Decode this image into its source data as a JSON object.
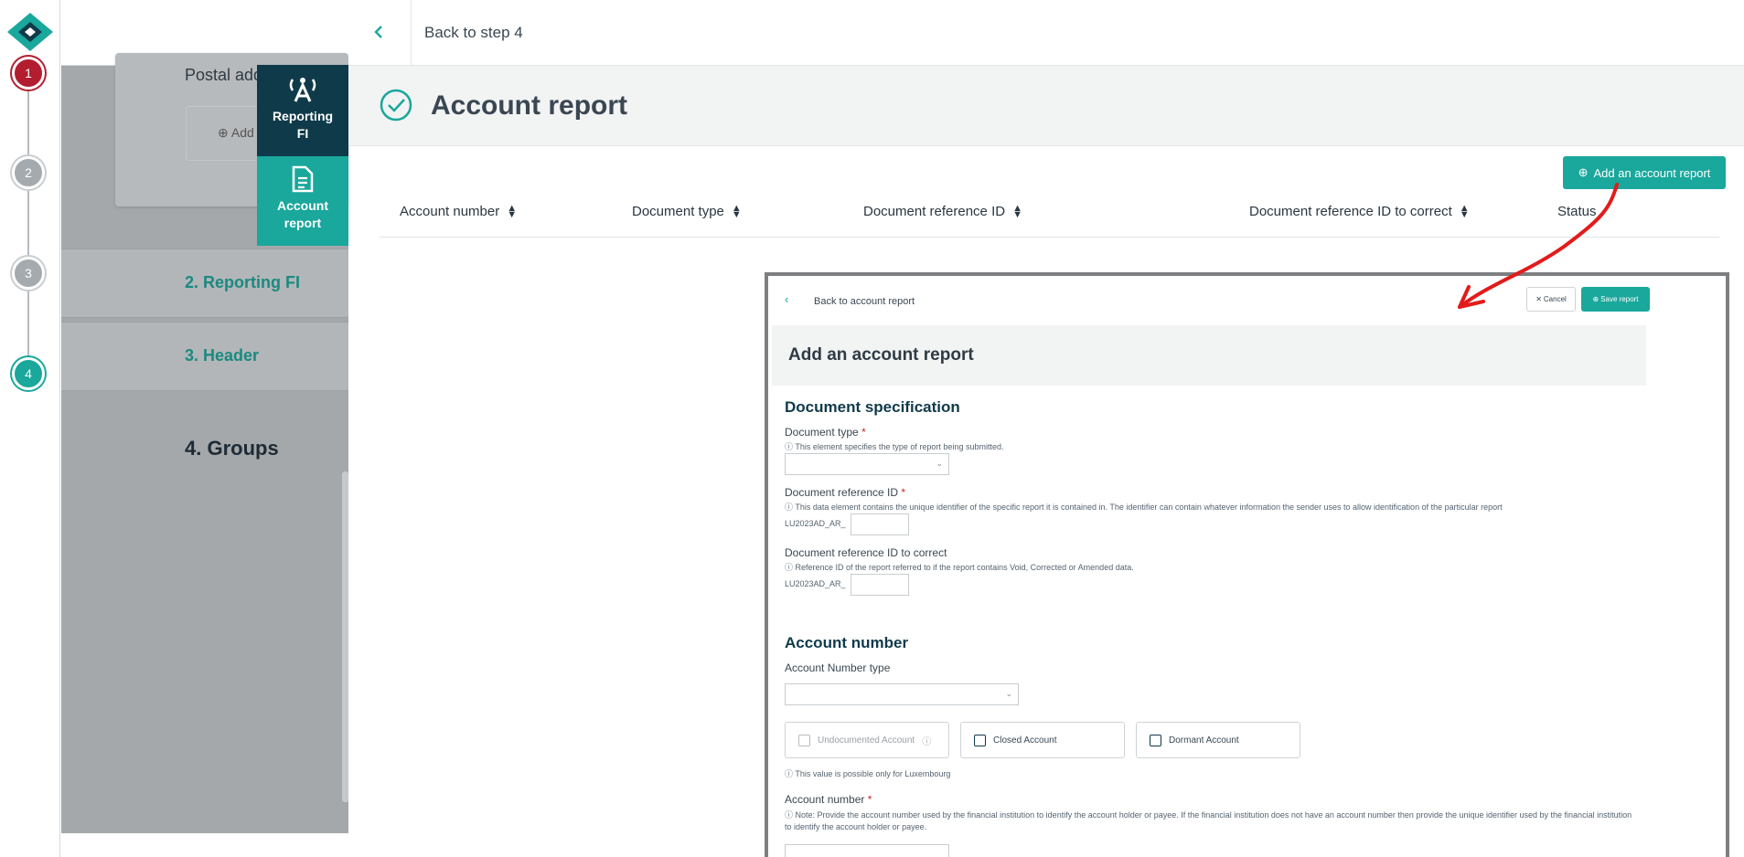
{
  "stepper": {
    "steps": [
      "1",
      "2",
      "3",
      "4"
    ]
  },
  "background": {
    "postal_label": "Postal add",
    "add_button_label": "Add",
    "sections": [
      "2. Reporting FI",
      "3. Header"
    ],
    "groups_title": "4. Groups"
  },
  "side_tabs": [
    {
      "label_line1": "Reporting",
      "label_line2": "FI",
      "icon": "antenna-person-icon"
    },
    {
      "label_line1": "Account",
      "label_line2": "report",
      "icon": "document-icon"
    }
  ],
  "topbar": {
    "back_label": "Back to step 4"
  },
  "page": {
    "title": "Account report"
  },
  "actions": {
    "add_account_report": "Add an account report"
  },
  "table": {
    "columns": [
      "Account number",
      "Document type",
      "Document reference ID",
      "Document reference ID to correct",
      "Status"
    ]
  },
  "inset": {
    "back_label": "Back to account report",
    "cancel_label": "Cancel",
    "save_label": "Save report",
    "title": "Add an account report",
    "doc_spec_heading": "Document specification",
    "doc_type_label": "Document type",
    "doc_type_help": "This element specifies the type of report being submitted.",
    "doc_ref_label": "Document reference ID",
    "doc_ref_help": "This data element contains the unique identifier of the specific report it is contained in. The identifier can contain whatever information the sender uses to allow identification of the particular report",
    "doc_ref_prefix": "LU2023AD_AR_",
    "doc_ref_correct_label": "Document reference ID to correct",
    "doc_ref_correct_help": "Reference ID of the report referred to if the report contains Void, Corrected or Amended data.",
    "doc_ref_correct_prefix": "LU2023AD_AR_",
    "account_number_heading": "Account number",
    "account_number_type_label": "Account Number type",
    "check_undocumented": "Undocumented Account",
    "check_closed": "Closed Account",
    "check_dormant": "Dormant Account",
    "lux_note": "This value is possible only for Luxembourg",
    "account_number_label": "Account number",
    "account_number_note": "Note: Provide the account number used by the financial institution to identify the account holder or payee. If the financial institution does not have an account number then provide the unique identifier used by the financial institution to identify the account holder or payee."
  },
  "colors": {
    "teal": "#1aa79c",
    "navy": "#0f3a4a",
    "red_step": "#b21e2f",
    "annotation_red": "#e21b1b"
  }
}
